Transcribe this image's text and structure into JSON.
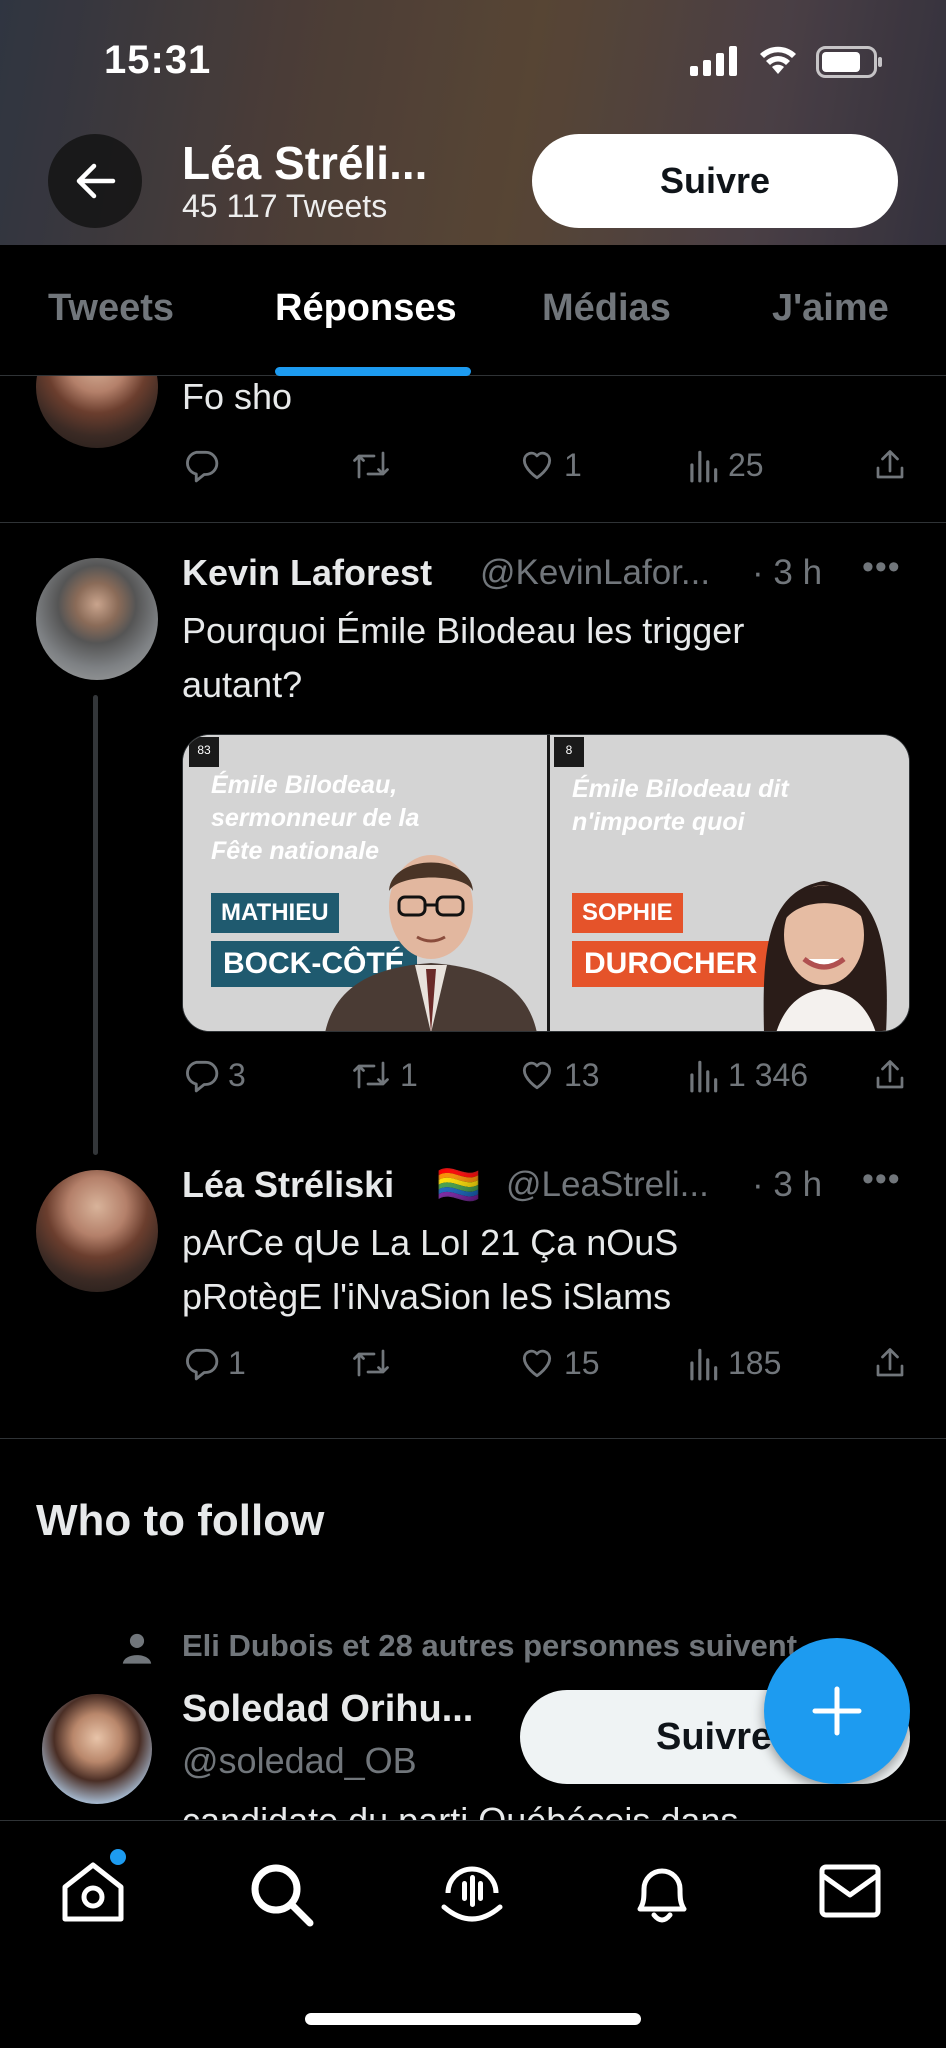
{
  "status_bar": {
    "time": "15:31"
  },
  "header": {
    "name": "Léa Stréli...",
    "tweet_count": "45 117 Tweets",
    "follow_label": "Suivre"
  },
  "tabs": [
    {
      "label": "Tweets",
      "active": false
    },
    {
      "label": "Réponses",
      "active": true
    },
    {
      "label": "Médias",
      "active": false
    },
    {
      "label": "J'aime",
      "active": false
    }
  ],
  "tweets": [
    {
      "text": "Fo sho",
      "actions": {
        "replies": "",
        "retweets": "",
        "likes": "1",
        "views": "25"
      }
    },
    {
      "author": "Kevin Laforest",
      "handle": "@KevinLafor...",
      "time": "· 3 h",
      "text_line1": "Pourquoi Émile Bilodeau les trigger",
      "text_line2": "autant?",
      "media": {
        "left": {
          "badge": "83",
          "quote": [
            "Émile Bilodeau,",
            "sermonneur de la",
            "Fête nationale"
          ],
          "tag1": "MATHIEU",
          "tag2": "BOCK-CÔTÉ"
        },
        "right": {
          "badge": "8",
          "quote": [
            "Émile Bilodeau dit",
            "n'importe quoi"
          ],
          "tag1": "SOPHIE",
          "tag2": "DUROCHER"
        }
      },
      "actions": {
        "replies": "3",
        "retweets": "1",
        "likes": "13",
        "views": "1 346"
      }
    },
    {
      "author": "Léa Stréliski",
      "flag": "🏳️‍🌈",
      "handle": "@LeaStreli...",
      "time": "· 3 h",
      "text_line1": "pArCe qUe La LoI 21 Ça nOuS",
      "text_line2": "pRotègE l'iNvaSion leS iSlams",
      "actions": {
        "replies": "1",
        "retweets": "",
        "likes": "15",
        "views": "185"
      }
    }
  ],
  "who_to_follow": {
    "title": "Who to follow",
    "social_context": "Eli Dubois et 28 autres personnes suivent",
    "suggestion": {
      "name": "Soledad Orihu...",
      "handle": "@soledad_OB",
      "bio": "candidate du parti Québécois dans",
      "follow_label": "Suivre"
    }
  },
  "colors": {
    "accent": "#1d9bf0",
    "background": "#000000",
    "muted": "#71767b",
    "text": "#e7e9ea"
  }
}
